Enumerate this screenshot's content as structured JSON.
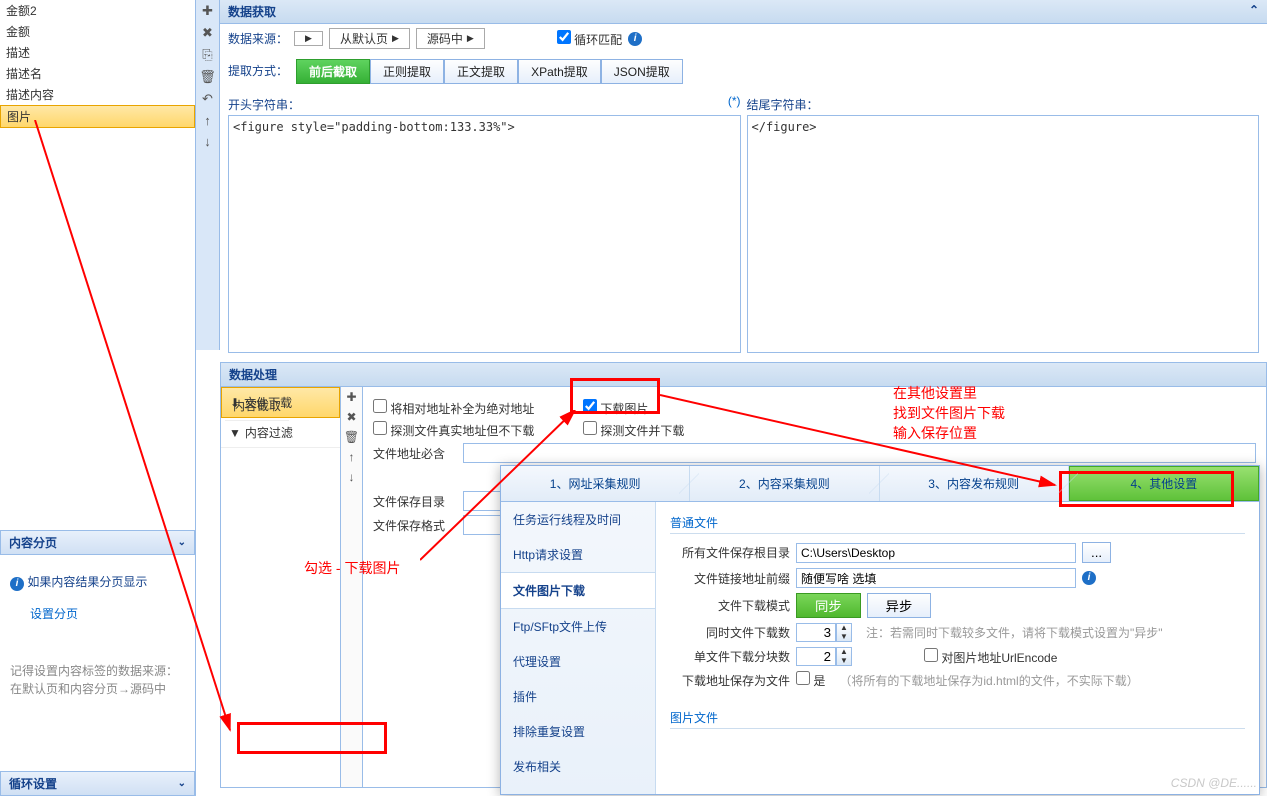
{
  "left_fields": {
    "items": [
      "金额2",
      "金额",
      "描述",
      "描述名",
      "描述内容",
      "图片"
    ],
    "selected_index": 5
  },
  "content_pagination": {
    "title": "内容分页",
    "info": "如果内容结果分页显示",
    "link": "设置分页",
    "hint1": "记得设置内容标签的数据来源：",
    "hint2": "在默认页和内容分页→源码中"
  },
  "loop_settings_title": "循环设置",
  "data_extract": {
    "title": "数据获取",
    "source_label": "数据来源：",
    "source_crumb1": "从默认页",
    "source_crumb2": "源码中",
    "loop_match": "循环匹配",
    "extract_label": "提取方式：",
    "tabs": [
      "前后截取",
      "正则提取",
      "正文提取",
      "XPath提取",
      "JSON提取"
    ],
    "start_label": "开头字符串：",
    "end_label": "结尾字符串：",
    "start_value": "<figure style=\"padding-bottom:133.33%\">",
    "end_value": "</figure>",
    "star": "(*)"
  },
  "data_process": {
    "title": "数据处理",
    "list": [
      {
        "label": "内容截取",
        "icon": "",
        "sel": false
      },
      {
        "label": "文件下载",
        "icon": "download",
        "sel": true
      },
      {
        "label": "内容过滤",
        "icon": "filter",
        "sel": false
      }
    ],
    "form": {
      "cb1": "将相对地址补全为绝对地址",
      "cb2": "下载图片",
      "cb3": "探测文件真实地址但不下载",
      "cb4": "探测文件并下载",
      "lbl_addr_contain": "文件地址必含",
      "lbl_save_dir": "文件保存目录",
      "lbl_save_fmt": "文件保存格式"
    }
  },
  "annotations": {
    "check_download": "勾选 - 下载图片",
    "other_settings_note": "在其他设置里\n找到文件图片下载\n输入保存位置"
  },
  "dialog": {
    "steps": [
      "1、网址采集规则",
      "2、内容采集规则",
      "3、内容发布规则",
      "4、其他设置"
    ],
    "side": [
      "任务运行线程及时间",
      "Http请求设置",
      "文件图片下载",
      "Ftp/SFtp文件上传",
      "代理设置",
      "插件",
      "排除重复设置",
      "发布相关"
    ],
    "side_selected": 2,
    "group1": "普通文件",
    "group2": "图片文件",
    "rows": {
      "save_root_lbl": "所有文件保存根目录",
      "save_root_val": "C:\\Users\\Desktop",
      "link_prefix_lbl": "文件链接地址前缀",
      "link_prefix_val": "随便写啥 选填",
      "dl_mode_lbl": "文件下载模式",
      "dl_sync": "同步",
      "dl_async": "异步",
      "concurrent_lbl": "同时文件下载数",
      "concurrent_val": "3",
      "concurrent_note": "注：若需同时下载较多文件，请将下载模式设置为\"异步\"",
      "chunks_lbl": "单文件下载分块数",
      "chunks_val": "2",
      "urlencode": "对图片地址UrlEncode",
      "save_as_file_lbl": "下载地址保存为文件",
      "save_as_file_cb": "是",
      "save_as_file_note": "（将所有的下载地址保存为id.html的文件，不实际下载）",
      "more_btn": "..."
    }
  },
  "watermark": "CSDN @DE......"
}
